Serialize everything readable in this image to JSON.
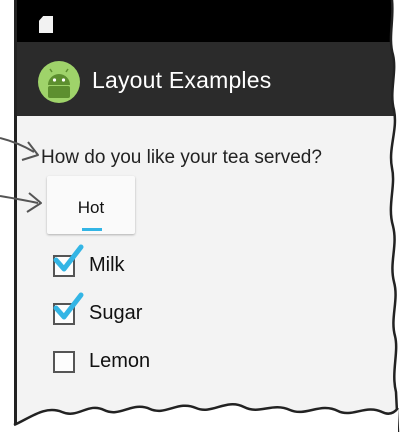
{
  "status_bar": {
    "sd_icon": "sd-card-icon"
  },
  "action_bar": {
    "app_icon": "android-icon",
    "title": "Layout Examples"
  },
  "form": {
    "question": "How do you like your tea served?",
    "spinner": {
      "selected": "Hot"
    },
    "checkboxes": [
      {
        "label": "Milk",
        "checked": true
      },
      {
        "label": "Sugar",
        "checked": true
      },
      {
        "label": "Lemon",
        "checked": false
      }
    ]
  },
  "colors": {
    "accent": "#33b5e5",
    "action_bar": "#2b2b2b",
    "android_green": "#a4c639"
  }
}
